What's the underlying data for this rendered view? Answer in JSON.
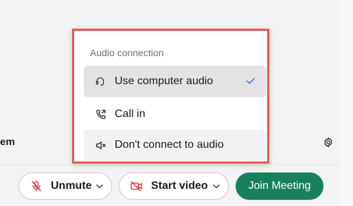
{
  "background": {
    "system_text": "em"
  },
  "audio_menu": {
    "heading": "Audio connection",
    "items": [
      {
        "label": "Use computer audio",
        "icon": "headset-icon",
        "selected": true
      },
      {
        "label": "Call in",
        "icon": "phone-call-icon",
        "selected": false
      },
      {
        "label": "Don't connect to audio",
        "icon": "speaker-mute-icon",
        "selected": false
      }
    ],
    "highlight_color": "#e8554f"
  },
  "toolbar": {
    "unmute_label": "Unmute",
    "start_video_label": "Start video",
    "join_label": "Join Meeting",
    "join_color": "#18815b",
    "mute_icon_color": "#d92d2a"
  }
}
